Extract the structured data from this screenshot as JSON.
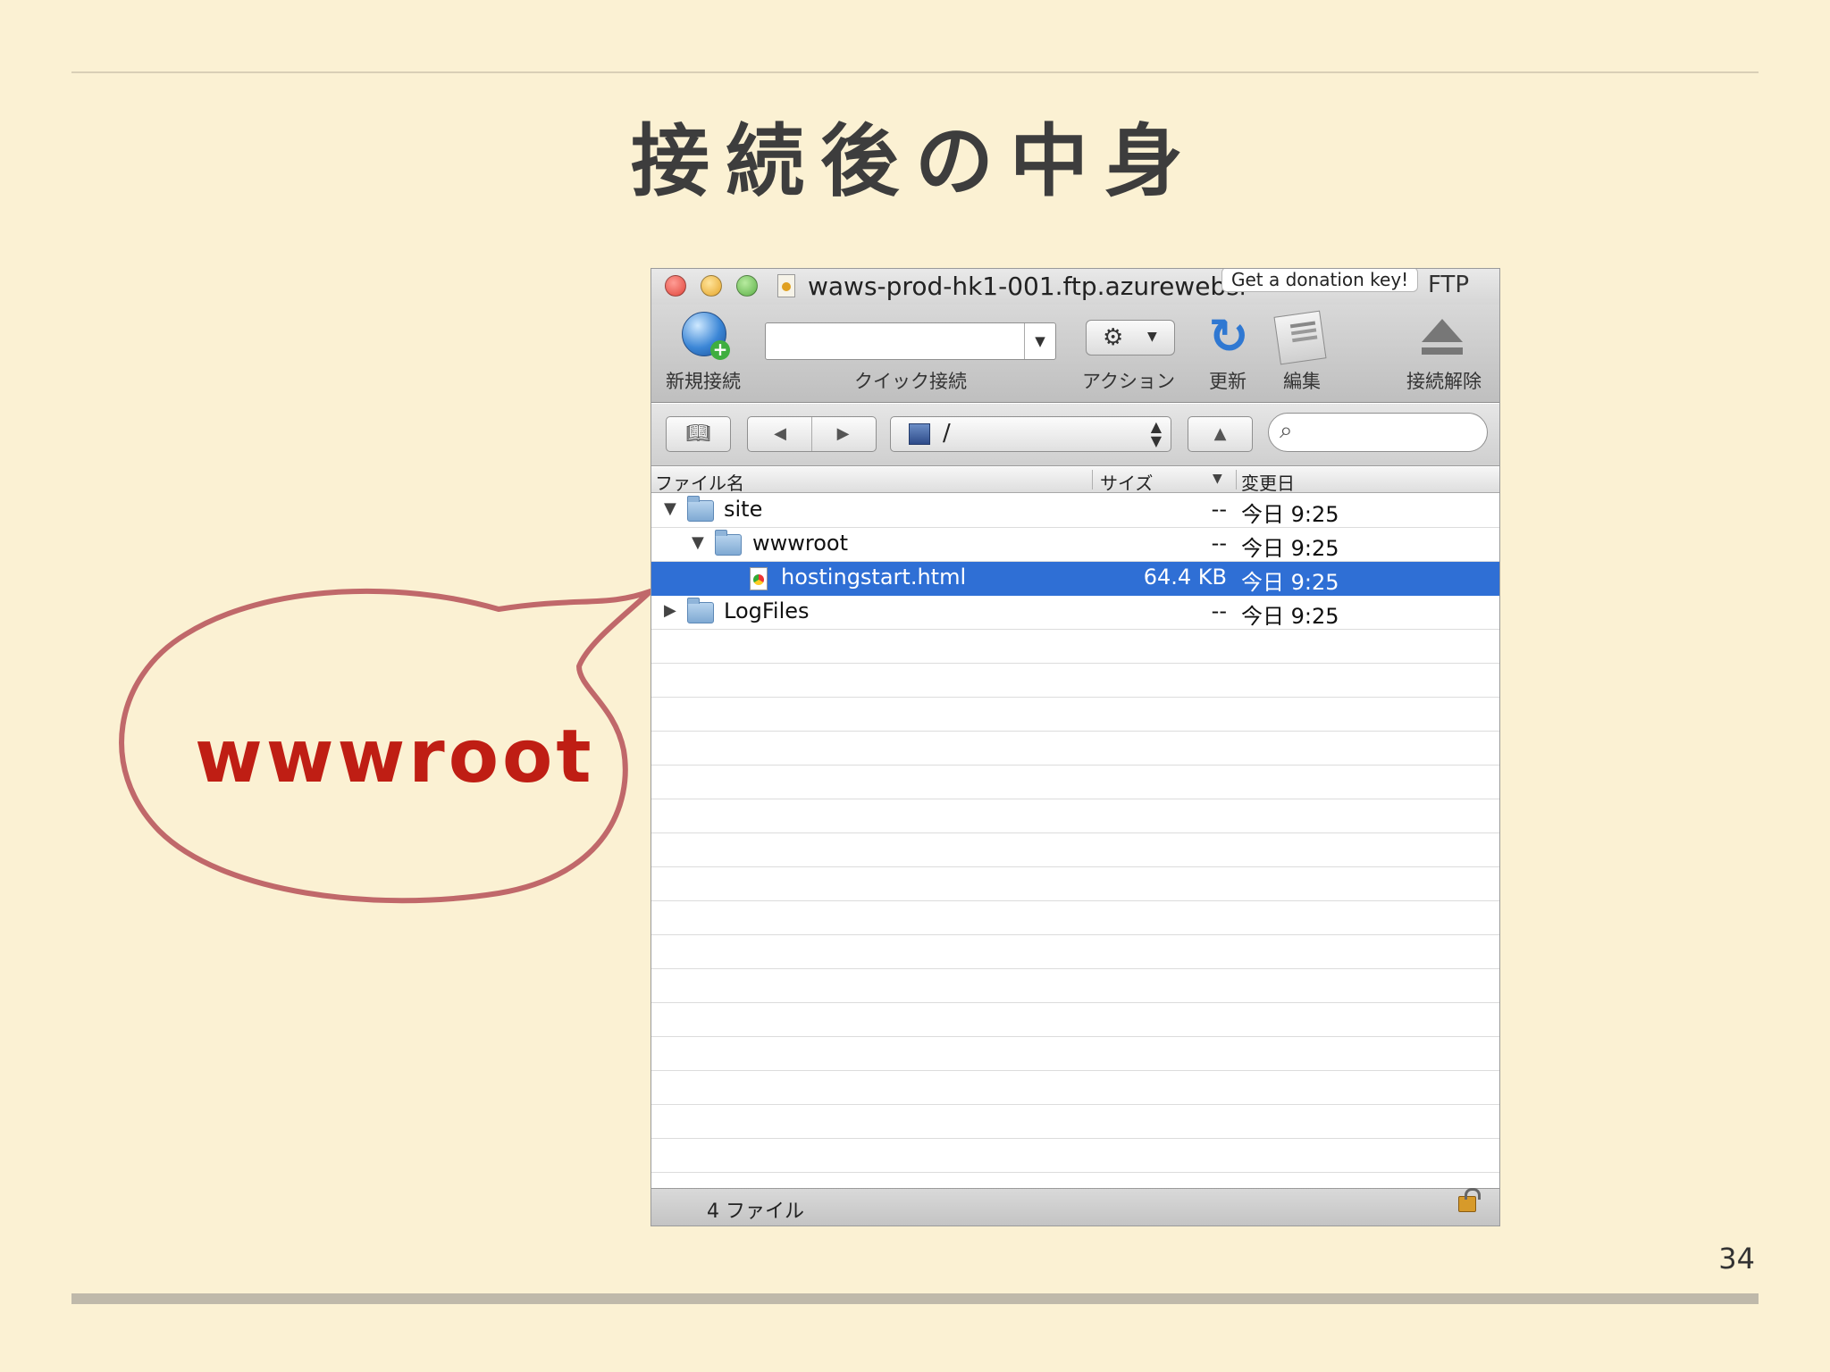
{
  "slide": {
    "title": "接続後の中身",
    "page_number": "34",
    "callout_text": "wwwroot"
  },
  "window": {
    "title": "waws-prod-hk1-001.ftp.azurewebsi",
    "title_suffix": "FTP",
    "donation_tooltip": "Get a donation key!"
  },
  "toolbar": {
    "new_connection": "新規接続",
    "quick_connect": "クイック接続",
    "action": "アクション",
    "refresh": "更新",
    "edit": "編集",
    "disconnect": "接続解除"
  },
  "navbar": {
    "path": "/"
  },
  "columns": {
    "name": "ファイル名",
    "size": "サイズ",
    "modified": "変更日"
  },
  "rows": [
    {
      "name": "site",
      "size": "--",
      "date": "今日 9:25"
    },
    {
      "name": "wwwroot",
      "size": "--",
      "date": "今日 9:25"
    },
    {
      "name": "hostingstart.html",
      "size": "64.4 KB",
      "date": "今日 9:25"
    },
    {
      "name": "LogFiles",
      "size": "--",
      "date": "今日 9:25"
    }
  ],
  "status": {
    "file_count": "4 ファイル"
  },
  "colors": {
    "selection": "#2f6fd5",
    "callout_stroke": "#c0686a",
    "callout_text": "#bf1e14",
    "background": "#fbf1d3"
  },
  "icons": {
    "new_connection": "globe-plus-icon",
    "action": "gear-icon",
    "refresh": "refresh-icon",
    "edit": "edit-document-icon",
    "disconnect": "eject-icon",
    "bookmarks": "book-icon",
    "search": "search-icon",
    "status": "lock-icon"
  }
}
